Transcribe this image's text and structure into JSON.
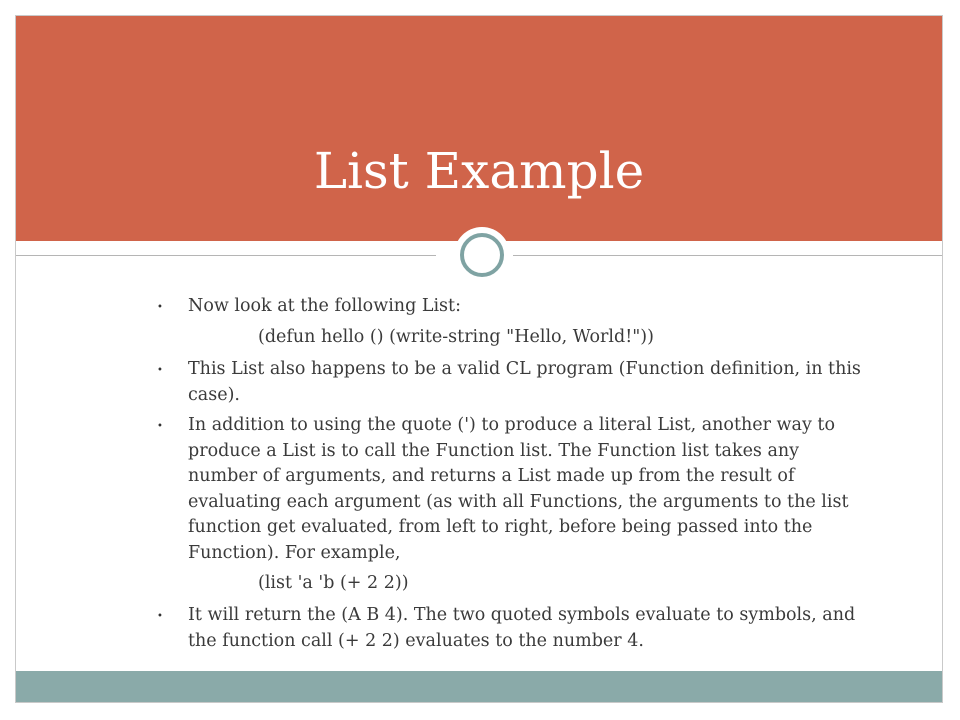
{
  "slide": {
    "title": "List Example",
    "colors": {
      "title_band": "#d0644a",
      "footer_band": "#8aaaa9",
      "ring": "#7fa3a3",
      "text": "#3a3a3a"
    },
    "bullet_symbol": "•",
    "bullets": [
      {
        "lines": [
          "Now look at the following List:"
        ],
        "code": "(defun hello () (write-string \"Hello, World!\"))"
      },
      {
        "lines": [
          "This List also happens to be a valid CL program (Function definition, in this",
          "case)."
        ]
      },
      {
        "lines": [
          "In addition to using the quote (') to produce a literal List, another way to",
          "produce a List is to call the Function list. The Function list takes any",
          "number of arguments, and returns a List made up from the result of",
          "evaluating each argument (as with all Functions, the arguments to the list",
          "function get evaluated, from left to right, before being passed into the",
          "Function). For example,"
        ],
        "code": "(list 'a 'b (+ 2 2))"
      },
      {
        "lines": [
          "It will return the (A B 4). The two quoted symbols evaluate to symbols, and",
          "the function call (+ 2 2) evaluates to the number 4."
        ]
      }
    ]
  }
}
